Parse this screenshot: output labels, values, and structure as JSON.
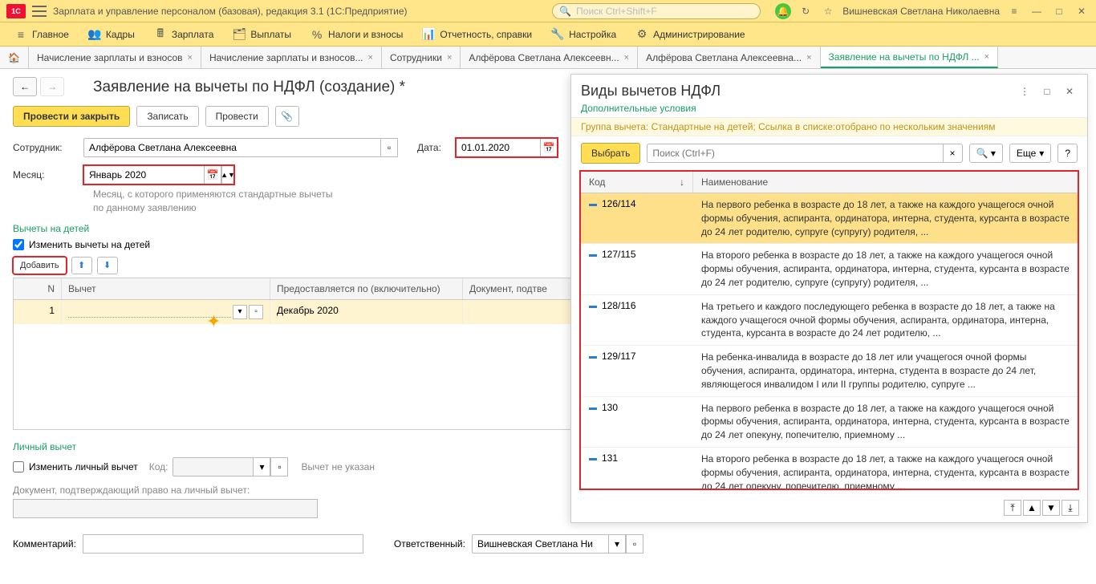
{
  "app": {
    "title": "Зарплата и управление персоналом (базовая), редакция 3.1  (1С:Предприятие)",
    "search_placeholder": "Поиск Ctrl+Shift+F",
    "user": "Вишневская Светлана Николаевна"
  },
  "nav": {
    "items": [
      {
        "icon": "≡",
        "label": "Главное"
      },
      {
        "icon": "👥",
        "label": "Кадры"
      },
      {
        "icon": "🖩",
        "label": "Зарплата"
      },
      {
        "icon": "🗂",
        "label": "Выплаты"
      },
      {
        "icon": "%",
        "label": "Налоги и взносы"
      },
      {
        "icon": "📊",
        "label": "Отчетность, справки"
      },
      {
        "icon": "🔧",
        "label": "Настройка"
      },
      {
        "icon": "⚙",
        "label": "Администрирование"
      }
    ]
  },
  "tabs": [
    {
      "label": "Начисление зарплаты и взносов",
      "close": true
    },
    {
      "label": "Начисление зарплаты и взносов...",
      "close": true
    },
    {
      "label": "Сотрудники",
      "close": true
    },
    {
      "label": "Алфёрова Светлана Алексеевн...",
      "close": true
    },
    {
      "label": "Алфёрова Светлана Алексеевна...",
      "close": true
    },
    {
      "label": "Заявление на вычеты по НДФЛ ...",
      "close": true,
      "active": true
    }
  ],
  "form": {
    "title": "Заявление на вычеты по НДФЛ (создание) *",
    "buttons": {
      "post_close": "Провести и закрыть",
      "save": "Записать",
      "post": "Провести"
    },
    "employee_label": "Сотрудник:",
    "employee_value": "Алфёрова Светлана Алексеевна",
    "date_label": "Дата:",
    "date_value": "01.01.2020",
    "month_label": "Месяц:",
    "month_value": "Январь 2020",
    "month_hint": "Месяц, с которого применяются стандартные вычеты по данному заявлению",
    "children_section": "Вычеты на детей",
    "children_checkbox": "Изменить вычеты на детей",
    "add_button": "Добавить",
    "table_headers": {
      "n": "N",
      "vychet": "Вычет",
      "until": "Предоставляется по (включительно)",
      "doc": "Документ, подтве"
    },
    "row1": {
      "n": "1",
      "until": "Декабрь 2020"
    },
    "personal_section": "Личный вычет",
    "personal_checkbox": "Изменить личный вычет",
    "code_label": "Код:",
    "no_vychet": "Вычет не указан",
    "doc_personal": "Документ, подтверждающий право на личный вычет:",
    "comment_label": "Комментарий:",
    "responsible_label": "Ответственный:",
    "responsible_value": "Вишневская Светлана Ни"
  },
  "panel": {
    "title": "Виды вычетов НДФЛ",
    "sub": "Дополнительные условия",
    "filter": "Группа вычета: Стандартные на детей; Ссылка в списке:отобрано по нескольким значениям",
    "select_btn": "Выбрать",
    "search_placeholder": "Поиск (Ctrl+F)",
    "more_btn": "Еще",
    "th_code": "Код",
    "th_name": "Наименование",
    "rows": [
      {
        "code": "126/114",
        "desc": "На первого ребенка в возрасте до 18 лет, а также на каждого учащегося очной формы обучения, аспиранта, ординатора, интерна, студента, курсанта в возрасте до 24 лет родителю, супруге (супругу) родителя, ...",
        "sel": true
      },
      {
        "code": "127/115",
        "desc": "На второго ребенка в возрасте до 18 лет, а также на каждого учащегося очной формы обучения, аспиранта, ординатора, интерна, студента, курсанта в возрасте до 24 лет родителю, супруге (супругу) родителя, ..."
      },
      {
        "code": "128/116",
        "desc": "На третьего и каждого последующего ребенка в возрасте до 18 лет, а также на каждого учащегося очной формы обучения, аспиранта, ординатора, интерна, студента, курсанта в возрасте до 24 лет родителю, ..."
      },
      {
        "code": "129/117",
        "desc": "На ребенка-инвалида в возрасте до 18 лет или учащегося очной формы обучения, аспиранта, ординатора, интерна, студента в возрасте до 24 лет, являющегося инвалидом I или II группы родителю, супруге ..."
      },
      {
        "code": "130",
        "desc": "На первого ребенка в возрасте до 18 лет, а также на каждого учащегося очной формы обучения, аспиранта, ординатора, интерна, студента, курсанта в возрасте до 24 лет опекуну, попечителю, приемному ..."
      },
      {
        "code": "131",
        "desc": "На второго ребенка в возрасте до 18 лет, а также на каждого учащегося очной формы обучения, аспиранта, ординатора, интерна, студента, курсанта в возрасте до 24 лет опекуну, попечителю, приемному ..."
      }
    ]
  }
}
